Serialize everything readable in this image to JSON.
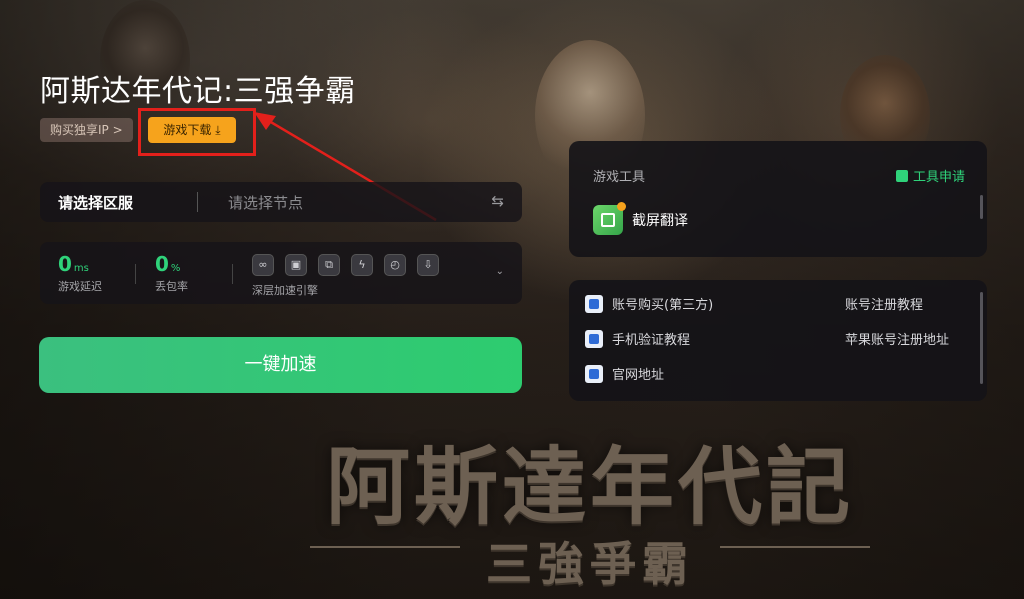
{
  "game": {
    "title": "阿斯达年代记:三强争霸",
    "buy_ip_label": "购买独享IP",
    "buy_ip_chevron": ">",
    "download_label": "游戏下载",
    "download_icon": "⤓"
  },
  "logo": {
    "main": "阿斯達年代記",
    "sub": "三強爭霸"
  },
  "selector": {
    "server_label": "请选择区服",
    "node_placeholder": "请选择节点",
    "swap_icon": "⇆"
  },
  "stats": {
    "latency": {
      "value": "0",
      "unit": "ms",
      "label": "游戏延迟"
    },
    "packet_loss": {
      "value": "0",
      "unit": "%",
      "label": "丢包率"
    },
    "engine_label": "深层加速引擎",
    "engine_icons": [
      "link-icon",
      "image-icon",
      "multi-icon",
      "lightning-icon",
      "timer-icon",
      "download-icon"
    ],
    "engine_glyphs": [
      "∞",
      "▣",
      "⧉",
      "ϟ",
      "◴",
      "⇩"
    ],
    "expand_icon": "⌄"
  },
  "accelerate_label": "一键加速",
  "tools": {
    "title": "游戏工具",
    "apply_label": "工具申请",
    "items": [
      {
        "name": "截屏翻译",
        "icon": "screenshot-translate-icon"
      }
    ]
  },
  "links": [
    {
      "label": "账号购买(第三方)"
    },
    {
      "label": "账号注册教程"
    },
    {
      "label": "手机验证教程"
    },
    {
      "label": "苹果账号注册地址"
    },
    {
      "label": "官网地址"
    }
  ],
  "colors": {
    "accent_green": "#2fd27a",
    "download_orange": "#f6a31c",
    "highlight_red": "#e3201b"
  }
}
